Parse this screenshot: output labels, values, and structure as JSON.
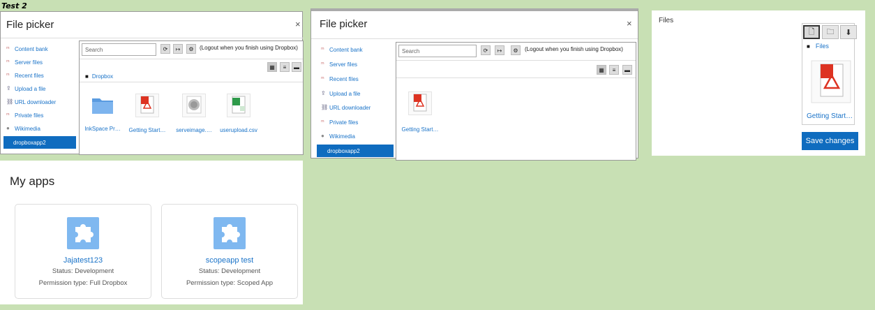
{
  "test_label": "Test 2",
  "picker1": {
    "title": "File picker",
    "close": "×",
    "nav": [
      "Content bank",
      "Server files",
      "Recent files",
      "Upload a file",
      "URL downloader",
      "Private files",
      "Wikimedia",
      "dropboxapp2"
    ],
    "search_placeholder": "Search",
    "logout_text": "(Logout when you finish using Dropbox)",
    "path": "Dropbox",
    "files": [
      "InkSpace Pr…",
      "Getting Start…",
      "serveimage.…",
      "userupload.csv"
    ]
  },
  "picker2": {
    "title": "File picker",
    "close": "×",
    "nav": [
      "Content bank",
      "Server files",
      "Recent files",
      "Upload a file",
      "URL downloader",
      "Private files",
      "Wikimedia",
      "dropboxapp2"
    ],
    "search_placeholder": "Search",
    "logout_text": "(Logout when you finish using Dropbox)",
    "files": [
      "Getting Start…"
    ]
  },
  "files_panel": {
    "label": "Files",
    "folder": "Files",
    "file": "Getting Start…",
    "save": "Save changes"
  },
  "apps": {
    "title": "My apps",
    "cards": [
      {
        "name": "Jajatest123",
        "status": "Status: Development",
        "permission": "Permission type: Full Dropbox"
      },
      {
        "name": "scopeapp test",
        "status": "Status: Development",
        "permission": "Permission type: Scoped App"
      }
    ]
  },
  "colors": {
    "accent": "#0f6cbf",
    "background": "#c8e0b4"
  }
}
